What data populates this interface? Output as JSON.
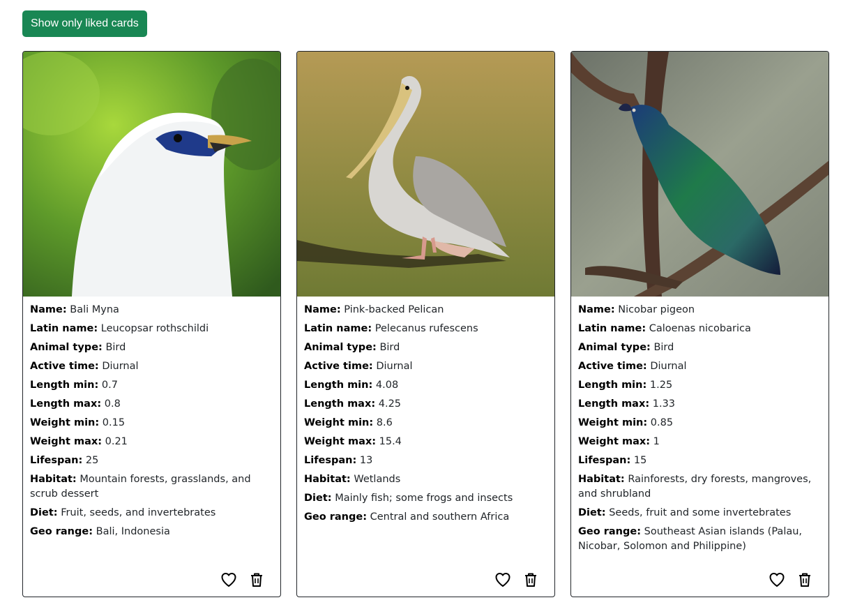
{
  "toolbar": {
    "filter_label": "Show only liked cards"
  },
  "labels": {
    "name": "Name:",
    "latin": "Latin name:",
    "type": "Animal type:",
    "active": "Active time:",
    "len_min": "Length min:",
    "len_max": "Length max:",
    "wt_min": "Weight min:",
    "wt_max": "Weight max:",
    "lifespan": "Lifespan:",
    "habitat": "Habitat:",
    "diet": "Diet:",
    "geo": "Geo range:"
  },
  "cards": [
    {
      "image": "bali-myna-photo",
      "name": "Bali Myna",
      "latin": "Leucopsar rothschildi",
      "type": "Bird",
      "active": "Diurnal",
      "len_min": "0.7",
      "len_max": "0.8",
      "wt_min": "0.15",
      "wt_max": "0.21",
      "lifespan": "25",
      "habitat": "Mountain forests, grasslands, and scrub dessert",
      "diet": "Fruit, seeds, and invertebrates",
      "geo": "Bali, Indonesia"
    },
    {
      "image": "pink-backed-pelican-photo",
      "name": "Pink-backed Pelican",
      "latin": "Pelecanus rufescens",
      "type": "Bird",
      "active": "Diurnal",
      "len_min": "4.08",
      "len_max": "4.25",
      "wt_min": "8.6",
      "wt_max": "15.4",
      "lifespan": "13",
      "habitat": "Wetlands",
      "diet": "Mainly fish; some frogs and insects",
      "geo": "Central and southern Africa"
    },
    {
      "image": "nicobar-pigeon-photo",
      "name": "Nicobar pigeon",
      "latin": "Caloenas nicobarica",
      "type": "Bird",
      "active": "Diurnal",
      "len_min": "1.25",
      "len_max": "1.33",
      "wt_min": "0.85",
      "wt_max": "1",
      "lifespan": "15",
      "habitat": "Rainforests, dry forests, mangroves, and shrubland",
      "diet": "Seeds, fruit and some invertebrates",
      "geo": "Southeast Asian islands (Palau, Nicobar, Solomon and Philippine)"
    }
  ],
  "icons": {
    "like": "heart-outline-icon",
    "delete": "trash-icon"
  },
  "colors": {
    "button_bg": "#198754",
    "button_text": "#ffffff",
    "card_border": "#212529"
  }
}
